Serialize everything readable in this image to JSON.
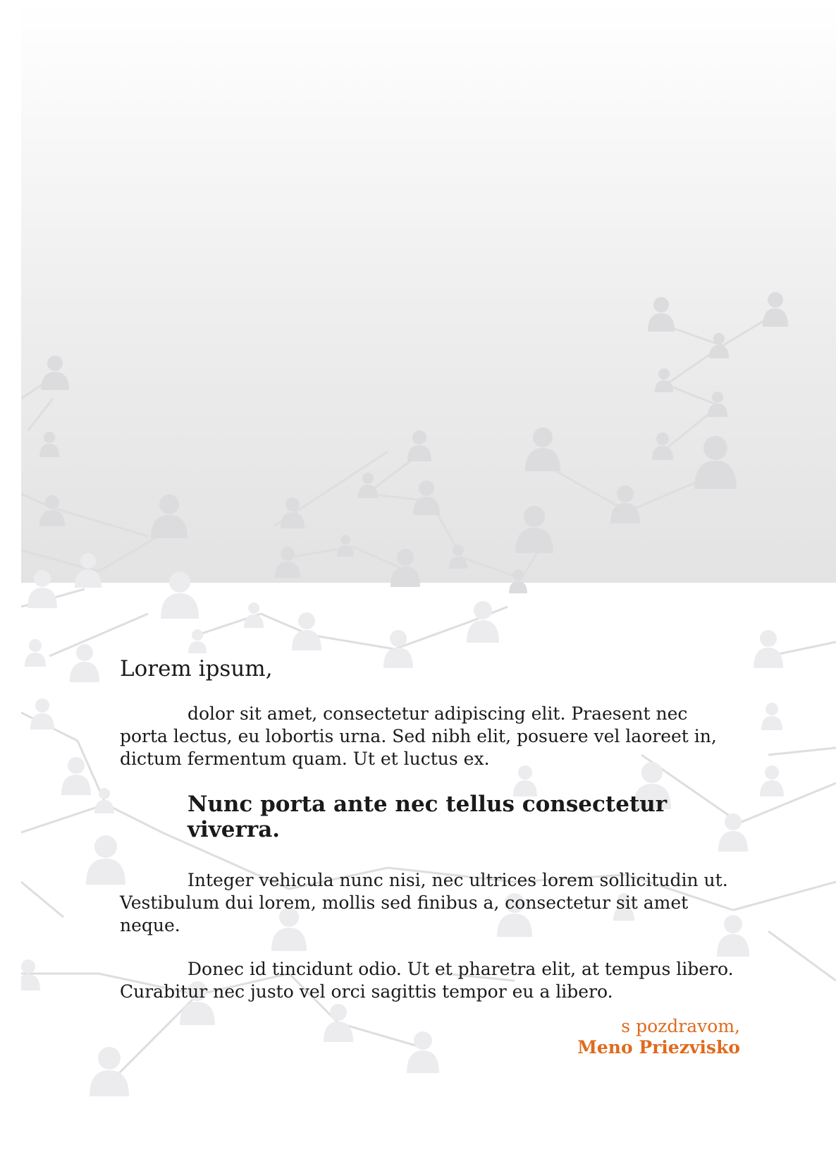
{
  "letter": {
    "greeting": "Lorem ipsum,",
    "paragraph1": "dolor sit amet, consectetur adipiscing elit. Praesent nec porta lectus, eu lobortis urna. Sed nibh elit, posuere vel laoreet in, dictum fermentum quam. Ut et luctus ex.",
    "heading": "Nunc porta ante nec tellus consectetur viverra.",
    "paragraph2": "Integer vehicula nunc nisi, nec ultrices lorem sollicitudin ut. Vestibulum dui lorem, mollis sed finibus a, consectetur sit amet neque.",
    "paragraph3": "Donec id tincidunt odio. Ut et pharetra elit, at tempus libero. Curabitur nec justo vel orci sagittis tempor eu a libero.",
    "closing": "s pozdravom,",
    "signature_name": "Meno Priezvisko"
  },
  "colors": {
    "accent": "#e06a1e",
    "background_pattern": "#e2e2e4"
  },
  "decoration": {
    "icon": "person-icon"
  }
}
